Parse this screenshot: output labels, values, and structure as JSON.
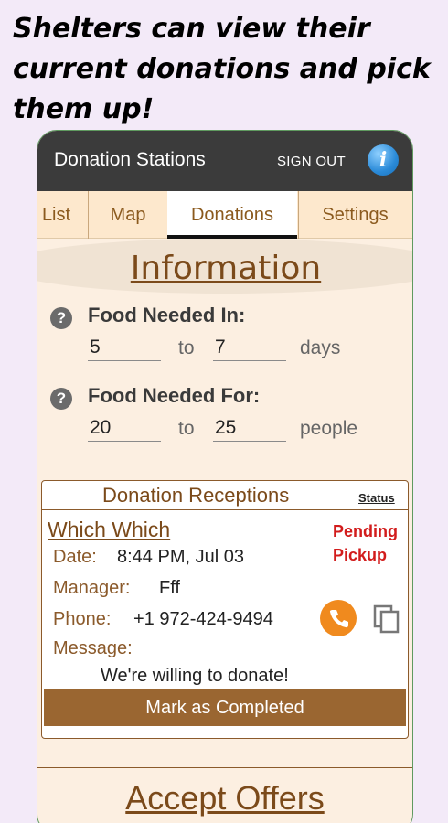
{
  "headline": "Shelters can view their current donations and pick them up!",
  "appbar": {
    "title": "Donation Stations",
    "signout_label": "SIGN OUT",
    "info_glyph": "i"
  },
  "tabs": [
    {
      "label": "List",
      "active": false
    },
    {
      "label": "Map",
      "active": false
    },
    {
      "label": "Donations",
      "active": true
    },
    {
      "label": "Settings",
      "active": false
    }
  ],
  "information": {
    "title": "Information",
    "help_glyph": "?",
    "food_needed_in": {
      "label": "Food Needed In:",
      "from": "5",
      "to_word": "to",
      "to": "7",
      "unit": "days"
    },
    "food_needed_for": {
      "label": "Food Needed For:",
      "from": "20",
      "to_word": "to",
      "to": "25",
      "unit": "people"
    }
  },
  "reception": {
    "title": "Donation Receptions",
    "status_label": "Status",
    "donor_name": "Which Which",
    "status": "Pending Pickup",
    "date_label": "Date:",
    "date_value": "8:44 PM, Jul 03",
    "manager_label": "Manager:",
    "manager_value": "Fff",
    "phone_label": "Phone:",
    "phone_value": "+1 972-424-9494",
    "message_label": "Message:",
    "message_value": "We're willing to donate!",
    "complete_label": "Mark as Completed"
  },
  "offers": {
    "title": "Accept Offers"
  },
  "colors": {
    "accent_brown": "#7b4a1a",
    "button_brown": "#9a6631",
    "pending_red": "#d21c1c",
    "call_orange": "#f08a1e",
    "appbar": "#3b3b3b"
  },
  "icons": {
    "info": "info-icon",
    "help": "help-icon",
    "call": "phone-icon",
    "copy": "copy-icon"
  }
}
